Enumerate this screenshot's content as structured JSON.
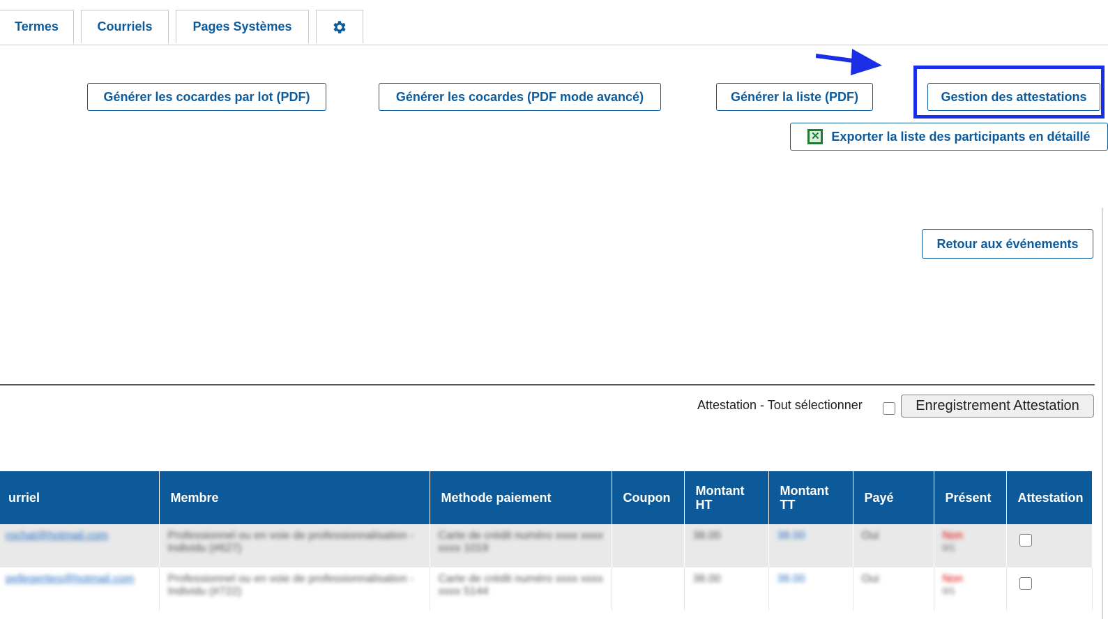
{
  "tabs": [
    {
      "label": "Termes"
    },
    {
      "label": "Courriels"
    },
    {
      "label": "Pages Systèmes"
    }
  ],
  "settings_tab_icon": "gear-icon",
  "toolbar": {
    "generate_badges_batch": "Générer les cocardes par lot (PDF)",
    "generate_badges_advanced": "Générer les cocardes (PDF mode avancé)",
    "generate_list": "Générer la liste (PDF)",
    "manage_attestations": "Gestion des attestations",
    "export_details": "Exporter la liste des participants en détaillé",
    "export_icon": "excel-icon",
    "back_to_events": "Retour aux événements"
  },
  "colors": {
    "accent": "#0d5a9a",
    "highlight": "#1a2ee6",
    "arrow": "#1a2ee6"
  },
  "attestation": {
    "select_all_label": "Attestation - Tout sélectionner",
    "save_button": "Enregistrement Attestation"
  },
  "table": {
    "headers": [
      "urriel",
      "Membre",
      "Methode paiement",
      "Coupon",
      "Montant HT",
      "Montant TT",
      "Payé",
      "Présent",
      "Attestation"
    ],
    "rows": [
      {
        "email": "rochat@hotmail.com",
        "member": "Professionnel ou en voie de professionnalisation - Individu (#627)",
        "payment": "Carte de crédit numéro xxxx xxxx xxxx 1019",
        "coupon": "",
        "amount_ht": "38.00",
        "amount_tt": "38.00",
        "paid": "Oui",
        "present": "Non",
        "present_sub": "0/1"
      },
      {
        "email": "pellegerties@hotmail.com",
        "member": "Professionnel ou en voie de professionnalisation - Individu (#722)",
        "payment": "Carte de crédit numéro xxxx xxxx xxxx 5144",
        "coupon": "",
        "amount_ht": "38.00",
        "amount_tt": "38.00",
        "paid": "Oui",
        "present": "Non",
        "present_sub": "0/1"
      }
    ]
  }
}
